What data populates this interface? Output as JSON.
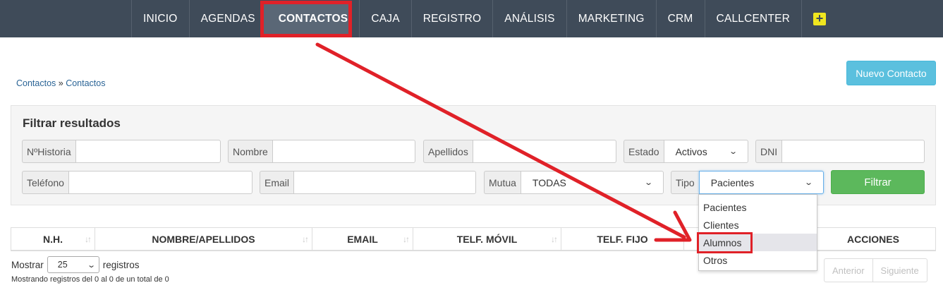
{
  "nav": {
    "items": [
      "INICIO",
      "AGENDAS",
      "CONTACTOS",
      "CAJA",
      "REGISTRO",
      "ANÁLISIS",
      "MARKETING",
      "CRM",
      "CALLCENTER"
    ],
    "plus_label": "+"
  },
  "breadcrumb": {
    "part1": "Contactos",
    "sep": " » ",
    "part2": "Contactos"
  },
  "new_contact_button": "Nuevo Contacto",
  "filter": {
    "title": "Filtrar resultados",
    "historia_label": "NºHistoria",
    "nombre_label": "Nombre",
    "apellidos_label": "Apellidos",
    "estado_label": "Estado",
    "estado_value": "Activos",
    "dni_label": "DNI",
    "telefono_label": "Teléfono",
    "email_label": "Email",
    "mutua_label": "Mutua",
    "mutua_value": "TODAS",
    "tipo_label": "Tipo",
    "tipo_value": "Pacientes",
    "filter_button": "Filtrar"
  },
  "tipo_options": [
    "Pacientes",
    "Clientes",
    "Alumnos",
    "Otros"
  ],
  "table": {
    "columns": [
      "N.H.",
      "NOMBRE/APELLIDOS",
      "EMAIL",
      "TELF. MÓVIL",
      "TELF. FIJO",
      "",
      "ACCIONES"
    ]
  },
  "length": {
    "prefix": "Mostrar",
    "value": "25",
    "suffix": "registros"
  },
  "info_text": "Mostrando registros del 0 al 0 de un total de 0",
  "pager": {
    "prev": "Anterior",
    "next": "Siguiente"
  },
  "colors": {
    "navbar": "#3f4b59",
    "annotation_red": "#e02128",
    "new_button": "#5bc0de",
    "filter_button": "#5cb85c"
  }
}
